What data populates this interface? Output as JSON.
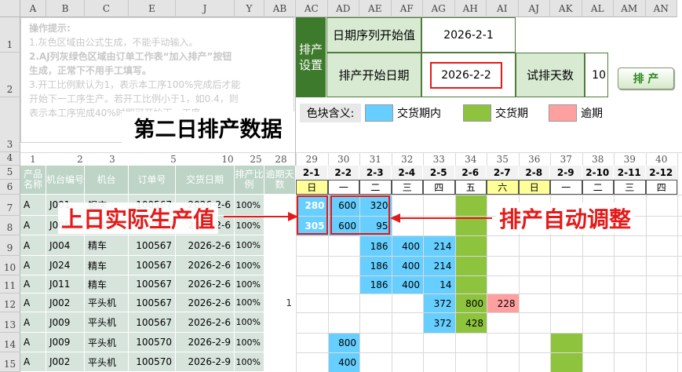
{
  "sheet": {
    "left_columns": [
      "A",
      "B",
      "C",
      "E",
      "J",
      "Y",
      "AB"
    ],
    "right_columns": [
      "AC",
      "AD",
      "AE",
      "AF",
      "AG",
      "AH",
      "AI",
      "AJ",
      "AK",
      "AL",
      "AM",
      "AN"
    ],
    "rows": [
      "1",
      "2",
      "3",
      "4",
      "5",
      "6",
      "7",
      "8",
      "9",
      "10",
      "11",
      "12",
      "13",
      "14",
      "15"
    ]
  },
  "tips": {
    "title": "操作提示:",
    "lines": [
      "1.灰色区域由公式生成，不能手动输入。",
      "2.AJ列灰绿色区域由订单工作表“加入排产”按钮",
      "生成，正常下不用手工填写。",
      "3.开工比例默认为1，表示本工序100%完成后才能",
      "开始下一工序生产。若开工比例小于1，如0.4，则",
      "表示本工序完成40%时即可开始下一工序"
    ]
  },
  "big_title": "第二日排产数据",
  "settings": {
    "section_label": "排产设置",
    "date_seq_label": "日期序列开始值",
    "date_seq_value": "2026-2-1",
    "start_date_label": "排产开始日期",
    "start_date_value": "2026-2-2",
    "trial_days_label": "试排天数",
    "trial_days_value": "10",
    "schedule_button": "排 产"
  },
  "legend": {
    "label": "色块含义:",
    "items": [
      {
        "name": "交货期内",
        "color": "#67cfff"
      },
      {
        "name": "交货期",
        "color": "#8dc33d"
      },
      {
        "name": "逾期",
        "color": "#ffa0a0"
      }
    ]
  },
  "col_numbers": [
    "1",
    "2",
    "3",
    "5",
    "10",
    "25",
    "28"
  ],
  "day_numbers": [
    "29",
    "30",
    "31",
    "32",
    "33",
    "34",
    "35",
    "36",
    "37",
    "38",
    "39",
    "40"
  ],
  "date_labels": [
    "2-1",
    "2-2",
    "2-3",
    "2-4",
    "2-5",
    "2-6",
    "2-7",
    "2-8",
    "2-9",
    "2-10",
    "2-11",
    "2-12"
  ],
  "weekdays": [
    "日",
    "一",
    "二",
    "三",
    "四",
    "五",
    "六",
    "日",
    "一",
    "二",
    "三",
    "四"
  ],
  "table_headers": [
    "产品名称",
    "机台编号",
    "机台",
    "订单号",
    "交货日期",
    "排产比例",
    "逾期天数"
  ],
  "table_rows": [
    {
      "product": "A",
      "machine_no": "J001",
      "machine": "锯床",
      "order": "100567",
      "due": "2026-2-6",
      "ratio": "100%",
      "overdue": ""
    },
    {
      "product": "A",
      "machine_no": "J005",
      "machine": "锯床",
      "order": "100567",
      "due": "2026-2-6",
      "ratio": "100%",
      "overdue": ""
    },
    {
      "product": "A",
      "machine_no": "J004",
      "machine": "精车",
      "order": "100567",
      "due": "2026-2-6",
      "ratio": "100%",
      "overdue": ""
    },
    {
      "product": "A",
      "machine_no": "J024",
      "machine": "精车",
      "order": "100567",
      "due": "2026-2-6",
      "ratio": "100%",
      "overdue": ""
    },
    {
      "product": "A",
      "machine_no": "J011",
      "machine": "精车",
      "order": "100567",
      "due": "2026-2-6",
      "ratio": "100%",
      "overdue": ""
    },
    {
      "product": "A",
      "machine_no": "J002",
      "machine": "平头机",
      "order": "100567",
      "due": "2026-2-6",
      "ratio": "100%",
      "overdue": "1"
    },
    {
      "product": "A",
      "machine_no": "J009",
      "machine": "平头机",
      "order": "100567",
      "due": "2026-2-6",
      "ratio": "100%",
      "overdue": ""
    },
    {
      "product": "A",
      "machine_no": "J009",
      "machine": "平头机",
      "order": "100570",
      "due": "2026-2-9",
      "ratio": "100%",
      "overdue": ""
    },
    {
      "product": "A",
      "machine_no": "J002",
      "machine": "平头机",
      "order": "100570",
      "due": "2026-2-9",
      "ratio": "100%",
      "overdue": ""
    }
  ],
  "schedule": [
    {
      "row": 0,
      "col": 0,
      "value": "280",
      "color": "blue",
      "bold": true,
      "white": true
    },
    {
      "row": 0,
      "col": 1,
      "value": "600",
      "color": "blue"
    },
    {
      "row": 0,
      "col": 2,
      "value": "320",
      "color": "blue"
    },
    {
      "row": 0,
      "col": 5,
      "value": "",
      "color": "green"
    },
    {
      "row": 1,
      "col": 0,
      "value": "305",
      "color": "blue",
      "bold": true,
      "white": true
    },
    {
      "row": 1,
      "col": 1,
      "value": "600",
      "color": "blue"
    },
    {
      "row": 1,
      "col": 2,
      "value": "95",
      "color": "blue"
    },
    {
      "row": 1,
      "col": 5,
      "value": "",
      "color": "green"
    },
    {
      "row": 2,
      "col": 2,
      "value": "186",
      "color": "blue"
    },
    {
      "row": 2,
      "col": 3,
      "value": "400",
      "color": "blue"
    },
    {
      "row": 2,
      "col": 4,
      "value": "214",
      "color": "blue"
    },
    {
      "row": 2,
      "col": 5,
      "value": "",
      "color": "green"
    },
    {
      "row": 3,
      "col": 2,
      "value": "186",
      "color": "blue"
    },
    {
      "row": 3,
      "col": 3,
      "value": "400",
      "color": "blue"
    },
    {
      "row": 3,
      "col": 4,
      "value": "214",
      "color": "blue"
    },
    {
      "row": 3,
      "col": 5,
      "value": "",
      "color": "green"
    },
    {
      "row": 4,
      "col": 2,
      "value": "186",
      "color": "blue"
    },
    {
      "row": 4,
      "col": 3,
      "value": "400",
      "color": "blue"
    },
    {
      "row": 4,
      "col": 4,
      "value": "14",
      "color": "blue"
    },
    {
      "row": 4,
      "col": 5,
      "value": "",
      "color": "green"
    },
    {
      "row": 5,
      "col": 4,
      "value": "372",
      "color": "blue"
    },
    {
      "row": 5,
      "col": 5,
      "value": "800",
      "color": "green"
    },
    {
      "row": 5,
      "col": 6,
      "value": "228",
      "color": "pink"
    },
    {
      "row": 6,
      "col": 4,
      "value": "372",
      "color": "blue"
    },
    {
      "row": 6,
      "col": 5,
      "value": "428",
      "color": "green"
    },
    {
      "row": 7,
      "col": 1,
      "value": "800",
      "color": "blue"
    },
    {
      "row": 7,
      "col": 8,
      "value": "",
      "color": "green"
    },
    {
      "row": 8,
      "col": 1,
      "value": "400",
      "color": "blue"
    },
    {
      "row": 8,
      "col": 8,
      "value": "",
      "color": "green"
    }
  ],
  "annotations": {
    "left": "上日实际生产值",
    "right": "排产自动调整"
  }
}
